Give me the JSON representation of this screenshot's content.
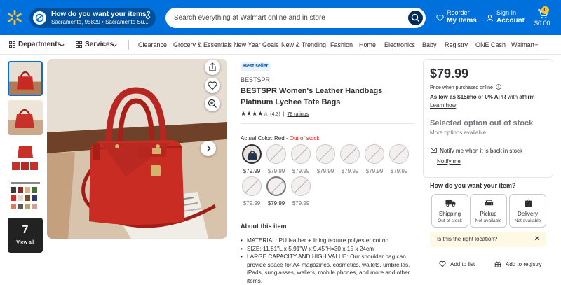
{
  "header": {
    "location_title": "How do you want your items?",
    "location_sub": "Sacramento, 95829 • Sacramento Su...",
    "search_placeholder": "Search everything at Walmart online and in store",
    "reorder_top": "Reorder",
    "reorder_bottom": "My Items",
    "signin_top": "Sign In",
    "signin_bottom": "Account",
    "cart_count": "0",
    "cart_total": "$0.00",
    "brand_color": "#0071dc",
    "spark_color": "#ffc220"
  },
  "nav": {
    "departments": "Departments",
    "services": "Services",
    "links": [
      "Clearance",
      "Grocery & Essentials",
      "New Year Goals",
      "New & Trending",
      "Fashion",
      "Home",
      "Electronics",
      "Baby",
      "Registry",
      "ONE Cash",
      "Walmart+"
    ]
  },
  "gallery": {
    "view_all_count": "7",
    "view_all_label": "View all"
  },
  "product": {
    "badge": "Best seller",
    "brand": "BESTSPR",
    "title": "BESTSPR Women's Leather Handbags Platinum Lychee Tote Bags",
    "rating_value": "(4.3)",
    "rating_stars": 4.3,
    "rating_count": "78 ratings",
    "color_label": "Actual Color:",
    "color_value": "Red",
    "color_sep": "-",
    "color_status": "Out of stock",
    "swatch_prices_row1": [
      "$79.99",
      "$79.99",
      "$79.99",
      "$79.99",
      "$79.99",
      "$79.99",
      "$79.99"
    ],
    "swatch_prices_row2": [
      "$79.99",
      "$79.99",
      "$79.99"
    ],
    "about_title": "About this item",
    "bullets": [
      "MATERIAL: PU leather + lining texture polyester cotton",
      "SIZE: 11.81\"L x 5.91\"W x 9.45\"H=30 x 15 x 24cm",
      "LARGE CAPACITY AND HIGH VALUE: Our shoulder bag can provide space for A4 magazines, cosmetics, wallets, umbrellas, iPads, sunglasses, wallets, mobile phones, and more and other items."
    ]
  },
  "buybox": {
    "price": "$79.99",
    "price_when": "Price when purchased online",
    "as_low_prefix": "As low as ",
    "as_low_amount": "$15/mo",
    "as_low_mid": " or ",
    "as_low_apr": "0% APR",
    "as_low_with": " with ",
    "affirm": "affirm",
    "learn_how": "Learn how",
    "selected_status": "Selected option out of stock",
    "more_options": "More options available",
    "notify_text": "Notify me when it is back in stock",
    "notify_link": "Notify me",
    "how_title": "How do you want your item?",
    "options": [
      {
        "name": "Shipping",
        "status": "Out of stock"
      },
      {
        "name": "Pickup",
        "status": "Not available"
      },
      {
        "name": "Delivery",
        "status": "Not available"
      }
    ],
    "location_question": "Is this the right location?",
    "add_to_list": "Add to list",
    "add_to_registry": "Add to registry"
  }
}
